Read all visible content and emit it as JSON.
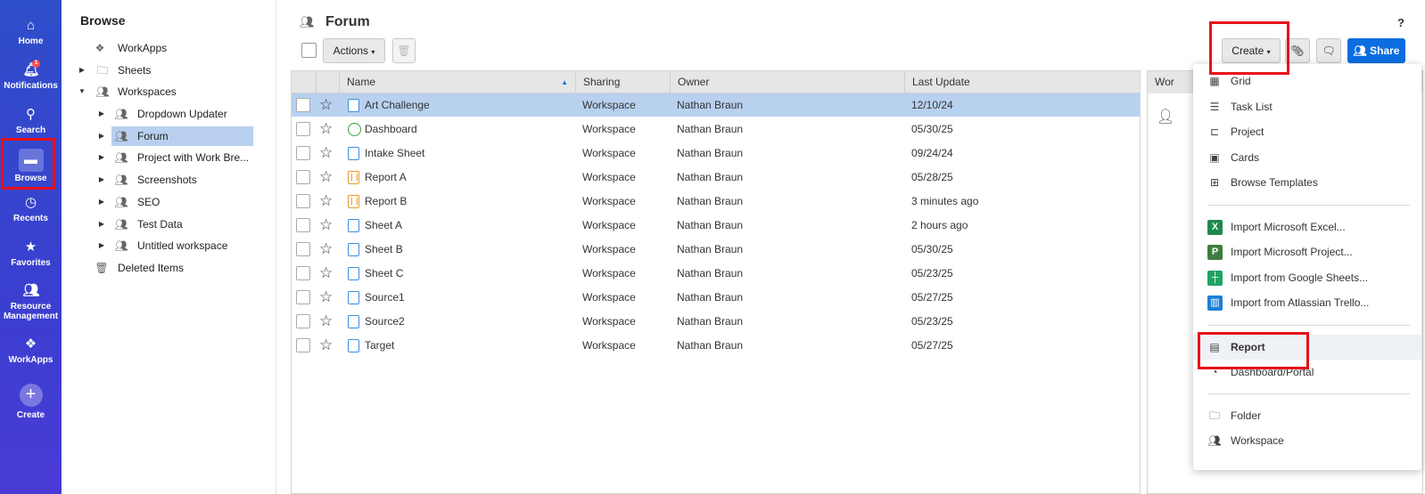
{
  "rail": {
    "home": "Home",
    "notifications": "Notifications",
    "notifications_count": "1",
    "search": "Search",
    "browse": "Browse",
    "recents": "Recents",
    "favorites": "Favorites",
    "resource_line1": "Resource",
    "resource_line2": "Management",
    "workapps": "WorkApps",
    "create": "Create"
  },
  "browse": {
    "title": "Browse",
    "items": [
      {
        "label": "WorkApps"
      },
      {
        "label": "Sheets"
      },
      {
        "label": "Workspaces"
      },
      {
        "label": "Dropdown Updater"
      },
      {
        "label": "Forum"
      },
      {
        "label": "Project with Work Bre..."
      },
      {
        "label": "Screenshots"
      },
      {
        "label": "SEO"
      },
      {
        "label": "Test Data"
      },
      {
        "label": "Untitled workspace"
      },
      {
        "label": "Deleted Items"
      }
    ]
  },
  "header": {
    "title": "Forum",
    "help": "?",
    "actions_label": "Actions",
    "create_label": "Create",
    "share_label": "Share"
  },
  "grid": {
    "columns": [
      "Name",
      "Sharing",
      "Owner",
      "Last Update"
    ],
    "rows": [
      {
        "name": "Art Challenge",
        "sharing": "Workspace",
        "owner": "Nathan Braun",
        "updated": "12/10/24",
        "kind": "sheet"
      },
      {
        "name": "Dashboard",
        "sharing": "Workspace",
        "owner": "Nathan Braun",
        "updated": "05/30/25",
        "kind": "dashboard"
      },
      {
        "name": "Intake Sheet",
        "sharing": "Workspace",
        "owner": "Nathan Braun",
        "updated": "09/24/24",
        "kind": "sheet"
      },
      {
        "name": "Report A",
        "sharing": "Workspace",
        "owner": "Nathan Braun",
        "updated": "05/28/25",
        "kind": "report"
      },
      {
        "name": "Report B",
        "sharing": "Workspace",
        "owner": "Nathan Braun",
        "updated": "3 minutes ago",
        "kind": "report"
      },
      {
        "name": "Sheet A",
        "sharing": "Workspace",
        "owner": "Nathan Braun",
        "updated": "2 hours ago",
        "kind": "sheet"
      },
      {
        "name": "Sheet B",
        "sharing": "Workspace",
        "owner": "Nathan Braun",
        "updated": "05/30/25",
        "kind": "sheet"
      },
      {
        "name": "Sheet C",
        "sharing": "Workspace",
        "owner": "Nathan Braun",
        "updated": "05/23/25",
        "kind": "sheet"
      },
      {
        "name": "Source1",
        "sharing": "Workspace",
        "owner": "Nathan Braun",
        "updated": "05/27/25",
        "kind": "sheet"
      },
      {
        "name": "Source2",
        "sharing": "Workspace",
        "owner": "Nathan Braun",
        "updated": "05/23/25",
        "kind": "sheet"
      },
      {
        "name": "Target",
        "sharing": "Workspace",
        "owner": "Nathan Braun",
        "updated": "05/27/25",
        "kind": "sheet"
      }
    ]
  },
  "side_panel": {
    "header": "Wor"
  },
  "create_menu": {
    "grid": "Grid",
    "task_list": "Task List",
    "project": "Project",
    "cards": "Cards",
    "browse_templates": "Browse Templates",
    "import_excel": "Import Microsoft Excel...",
    "import_project": "Import Microsoft Project...",
    "import_google": "Import from Google Sheets...",
    "import_trello": "Import from Atlassian Trello...",
    "report": "Report",
    "dashboard": "Dashboard/Portal",
    "folder": "Folder",
    "workspace": "Workspace"
  },
  "colors": {
    "rail_top": "#2f4ec9",
    "share_blue": "#0b6de0",
    "selected_row": "#b8d1ef",
    "highlight_red": "#e8101a"
  }
}
